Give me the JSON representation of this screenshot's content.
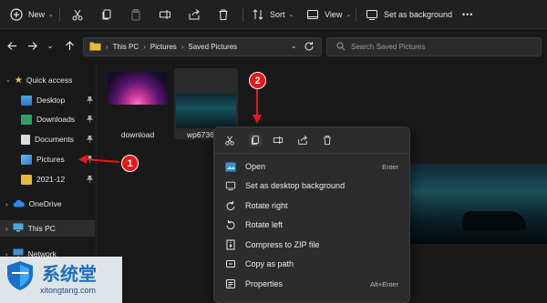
{
  "toolbar": {
    "new_label": "New",
    "sort_label": "Sort",
    "view_label": "View",
    "set_bg_label": "Set as background",
    "more_label": "•••"
  },
  "address": {
    "segments": [
      "This PC",
      "Pictures",
      "Saved Pictures"
    ],
    "separator": "›"
  },
  "search": {
    "placeholder": "Search Saved Pictures"
  },
  "sidebar": {
    "items": [
      {
        "label": "Quick access",
        "icon": "star-icon"
      },
      {
        "label": "Desktop",
        "icon": "desktop-folder-icon",
        "pinned": true
      },
      {
        "label": "Downloads",
        "icon": "downloads-folder-icon",
        "pinned": true
      },
      {
        "label": "Documents",
        "icon": "documents-folder-icon",
        "pinned": true
      },
      {
        "label": "Pictures",
        "icon": "pictures-folder-icon",
        "pinned": true
      },
      {
        "label": "2021-12",
        "icon": "folder-icon",
        "pinned": true
      },
      {
        "label": "OneDrive",
        "icon": "cloud-icon"
      },
      {
        "label": "This PC",
        "icon": "computer-icon"
      },
      {
        "label": "Network",
        "icon": "network-icon"
      }
    ]
  },
  "files": [
    {
      "name": "download"
    },
    {
      "name": "wp6736"
    }
  ],
  "context_menu": {
    "top_actions": [
      "cut-icon",
      "copy-icon",
      "rename-icon",
      "share-icon",
      "delete-icon"
    ],
    "items": [
      {
        "label": "Open",
        "shortcut": "Enter",
        "icon": "open-icon"
      },
      {
        "label": "Set as desktop background",
        "shortcut": "",
        "icon": "wallpaper-icon"
      },
      {
        "label": "Rotate right",
        "shortcut": "",
        "icon": "rotate-right-icon"
      },
      {
        "label": "Rotate left",
        "shortcut": "",
        "icon": "rotate-left-icon"
      },
      {
        "label": "Compress to ZIP file",
        "shortcut": "",
        "icon": "zip-icon"
      },
      {
        "label": "Copy as path",
        "shortcut": "",
        "icon": "path-icon"
      },
      {
        "label": "Properties",
        "shortcut": "Alt+Enter",
        "icon": "properties-icon"
      }
    ]
  },
  "annotations": {
    "badge1": "1",
    "badge2": "2"
  },
  "watermark": {
    "text": "系统堂",
    "url": "xitongtang.com"
  },
  "colors": {
    "accent": "#0078d4",
    "annotation_red": "#e81818",
    "folder_yellow": "#e8b93a"
  }
}
